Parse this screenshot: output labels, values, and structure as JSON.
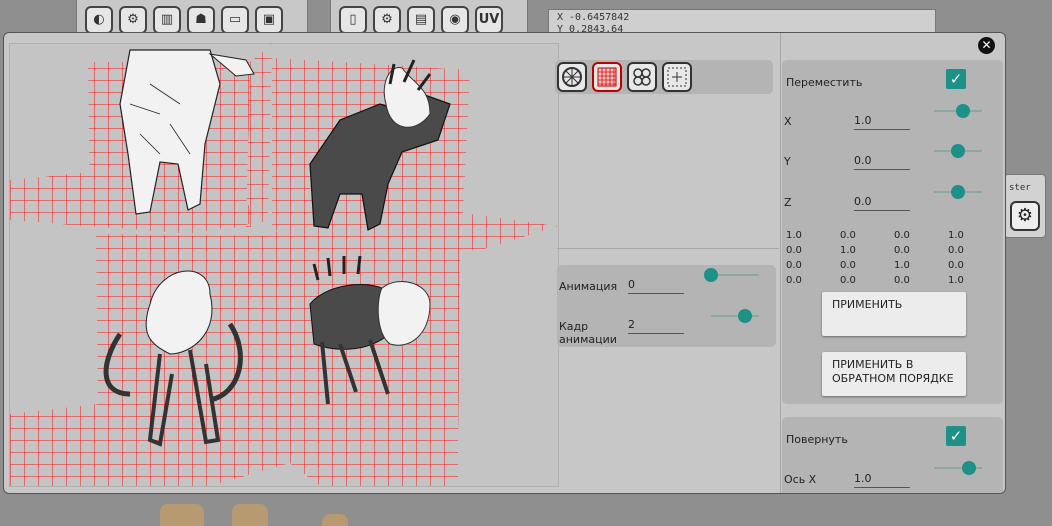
{
  "background": {
    "coords_line1": "X -0.6457842",
    "coords_line2": "Y 0.2843.64",
    "side_label": "ster",
    "uv_label": "UV"
  },
  "close_icon": "close-icon",
  "mode_buttons": [
    {
      "icon": "sphere-icon",
      "active": false
    },
    {
      "icon": "grid-icon",
      "active": true
    },
    {
      "icon": "multi-sphere-icon",
      "active": false
    },
    {
      "icon": "pivot-icon",
      "active": false
    }
  ],
  "animation": {
    "anim_label": "Анимация",
    "anim_value": "0",
    "frame_label_1": "Кадр",
    "frame_label_2": "анимации",
    "frame_value": "2",
    "anim_slider": 0.0,
    "frame_slider": 0.7
  },
  "move": {
    "title": "Переместить",
    "checked": true,
    "x_label": "X",
    "x_value": "1.0",
    "y_label": "Y",
    "y_value": "0.0",
    "z_label": "Z",
    "z_value": "0.0",
    "x_slider": 0.6,
    "y_slider": 0.5,
    "z_slider": 0.5,
    "matrix": [
      [
        "1.0",
        "0.0",
        "0.0",
        "1.0"
      ],
      [
        "0.0",
        "1.0",
        "0.0",
        "0.0"
      ],
      [
        "0.0",
        "0.0",
        "1.0",
        "0.0"
      ],
      [
        "0.0",
        "0.0",
        "0.0",
        "1.0"
      ]
    ],
    "apply_label": "ПРИМЕНИТЬ",
    "apply_reverse_label_1": "ПРИМЕНИТЬ В",
    "apply_reverse_label_2": "ОБРАТНОМ ПОРЯДКЕ"
  },
  "rotate": {
    "title": "Повернуть",
    "checked": true,
    "axis_label": "Ось X",
    "axis_value": "1.0"
  },
  "colors": {
    "accent": "#1d9088",
    "grid": "#ff0000",
    "panel": "#b4b4b4"
  }
}
